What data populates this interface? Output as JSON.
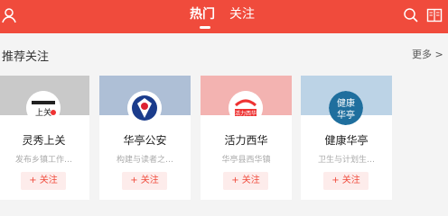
{
  "header": {
    "tabs": [
      {
        "label": "热门",
        "active": true
      },
      {
        "label": "关注",
        "active": false
      }
    ],
    "icons": [
      "user-icon",
      "search-icon",
      "news-icon"
    ],
    "bg_color": "#f04b3c"
  },
  "section": {
    "title": "推荐关注",
    "more_label": "更多 >"
  },
  "cards": [
    {
      "name": "灵秀上关",
      "desc": "发布乡镇工作…",
      "follow_label": "+ 关注",
      "banner_color": "#bdbdbd",
      "avatar_text": "上关"
    },
    {
      "name": "华亭公安",
      "desc": "构建与读者之…",
      "follow_label": "+ 关注",
      "banner_color": "#aebfd6",
      "avatar_text": ""
    },
    {
      "name": "活力西华",
      "desc": "华亭县西华镇",
      "follow_label": "+ 关注",
      "banner_color": "#f3b3b1",
      "avatar_text": "活力西华"
    },
    {
      "name": "健康华亭",
      "desc": "卫生与计划生…",
      "follow_label": "+ 关注",
      "banner_color": "#bcd3e6",
      "avatar_text": "健康华亭"
    }
  ]
}
